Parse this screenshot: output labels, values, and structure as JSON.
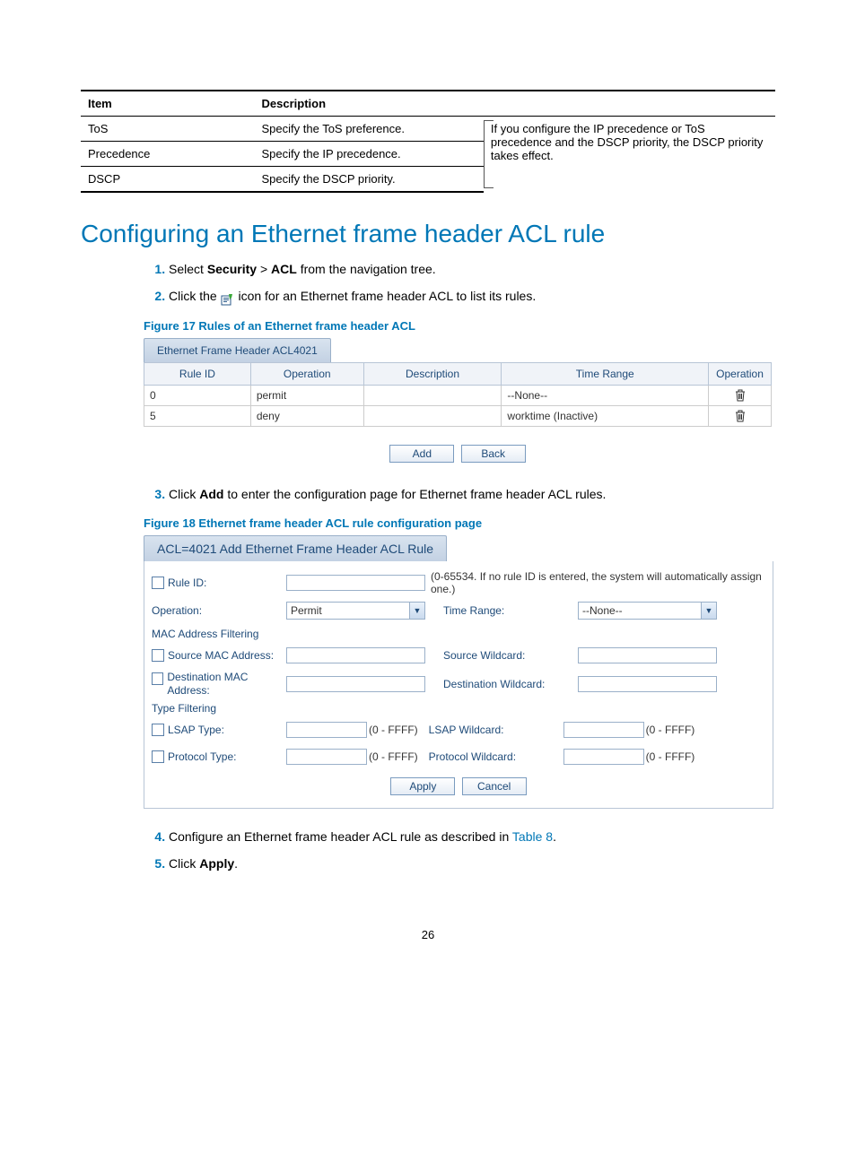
{
  "desc_table": {
    "headers": [
      "Item",
      "Description"
    ],
    "rows": [
      {
        "item": "ToS",
        "desc": "Specify the ToS preference."
      },
      {
        "item": "Precedence",
        "desc": "Specify the IP precedence."
      },
      {
        "item": "DSCP",
        "desc": "Specify the DSCP priority."
      }
    ],
    "note": "If you configure the IP precedence or ToS precedence and the DSCP priority, the DSCP priority takes effect."
  },
  "section_title": "Configuring an Ethernet frame header ACL rule",
  "steps": {
    "s1_pre": "Select ",
    "s1_b1": "Security",
    "s1_mid": " > ",
    "s1_b2": "ACL",
    "s1_post": " from the navigation tree.",
    "s2_pre": "Click the ",
    "s2_post": " icon for an Ethernet frame header ACL to list its rules.",
    "s3_pre": "Click ",
    "s3_b": "Add",
    "s3_post": " to enter the configuration page for Ethernet frame header ACL rules.",
    "s4_pre": "Configure an Ethernet frame header ACL rule as described in ",
    "s4_link": "Table 8",
    "s4_post": ".",
    "s5_pre": "Click ",
    "s5_b": "Apply",
    "s5_post": "."
  },
  "fig17": {
    "caption": "Figure 17 Rules of an Ethernet frame header ACL",
    "tab": "Ethernet Frame Header ACL4021",
    "headers": [
      "Rule ID",
      "Operation",
      "Description",
      "Time Range",
      "Operation"
    ],
    "rows": [
      {
        "id": "0",
        "op": "permit",
        "desc": "",
        "tr": "--None--"
      },
      {
        "id": "5",
        "op": "deny",
        "desc": "",
        "tr": "worktime (Inactive)"
      }
    ],
    "add": "Add",
    "back": "Back"
  },
  "fig18": {
    "caption": "Figure 18 Ethernet frame header ACL rule configuration page",
    "tab": "ACL=4021 Add Ethernet Frame Header ACL Rule",
    "rule_id_label": "Rule ID:",
    "rule_id_hint": "(0-65534. If no rule ID is entered, the system will automatically assign one.)",
    "operation_label": "Operation:",
    "operation_value": "Permit",
    "timerange_label": "Time Range:",
    "timerange_value": "--None--",
    "mac_header": "MAC Address Filtering",
    "src_mac_label": "Source MAC Address:",
    "src_wc_label": "Source Wildcard:",
    "dst_mac_label": "Destination MAC Address:",
    "dst_wc_label": "Destination Wildcard:",
    "type_header": "Type Filtering",
    "lsap_label": "LSAP Type:",
    "lsap_wc_label": "LSAP Wildcard:",
    "proto_label": "Protocol Type:",
    "proto_wc_label": "Protocol Wildcard:",
    "range_hint": "(0 - FFFF)",
    "apply": "Apply",
    "cancel": "Cancel"
  },
  "page_number": "26"
}
